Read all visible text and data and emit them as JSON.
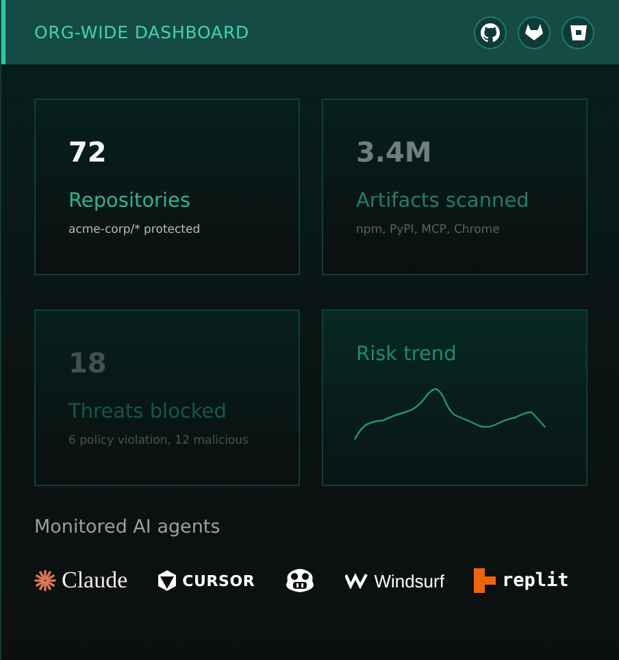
{
  "header": {
    "title": "ORG-WIDE DASHBOARD"
  },
  "cards": [
    {
      "kind": "stat",
      "value": "72",
      "label": "Repositories",
      "note": "acme-corp/* protected"
    },
    {
      "kind": "stat",
      "value": "3.4M",
      "label": "Artifacts scanned",
      "note": "npm, PyPI, MCP, Chrome"
    },
    {
      "kind": "stat",
      "value": "18",
      "label": "Threats blocked",
      "note": "6 policy violation, 12 malicious"
    },
    {
      "kind": "trend",
      "label": "Risk trend"
    }
  ],
  "agents": {
    "title": "Monitored AI agents",
    "items": [
      {
        "kind": "claude",
        "label": "Claude"
      },
      {
        "kind": "cursor",
        "label": "CURSOR"
      },
      {
        "kind": "copilot"
      },
      {
        "kind": "windsurf",
        "label": "Windsurf"
      },
      {
        "kind": "replit",
        "label": "replit"
      }
    ]
  }
}
